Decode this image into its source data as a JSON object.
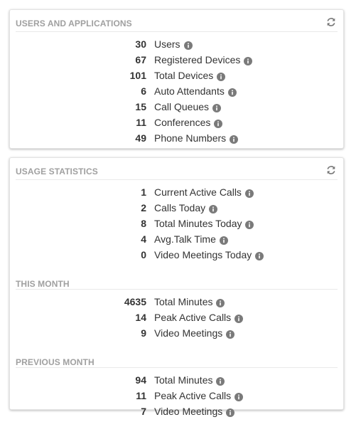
{
  "users_card": {
    "title": "USERS AND APPLICATIONS",
    "rows": [
      {
        "value": "30",
        "label": "Users"
      },
      {
        "value": "67",
        "label": "Registered Devices"
      },
      {
        "value": "101",
        "label": "Total Devices"
      },
      {
        "value": "6",
        "label": "Auto Attendants"
      },
      {
        "value": "15",
        "label": "Call Queues"
      },
      {
        "value": "11",
        "label": "Conferences"
      },
      {
        "value": "49",
        "label": "Phone Numbers"
      }
    ]
  },
  "usage_card": {
    "title": "USAGE STATISTICS",
    "today_rows": [
      {
        "value": "1",
        "label": "Current Active Calls"
      },
      {
        "value": "2",
        "label": "Calls Today"
      },
      {
        "value": "8",
        "label": "Total Minutes Today"
      },
      {
        "value": "4",
        "label": "Avg.Talk Time"
      },
      {
        "value": "0",
        "label": "Video Meetings Today"
      }
    ],
    "this_month_title": "THIS MONTH",
    "this_month_rows": [
      {
        "value": "4635",
        "label": "Total Minutes"
      },
      {
        "value": "14",
        "label": "Peak Active Calls"
      },
      {
        "value": "9",
        "label": "Video Meetings"
      }
    ],
    "previous_month_title": "PREVIOUS MONTH",
    "previous_month_rows": [
      {
        "value": "94",
        "label": "Total Minutes"
      },
      {
        "value": "11",
        "label": "Peak Active Calls"
      },
      {
        "value": "7",
        "label": "Video Meetings"
      }
    ]
  },
  "icons": {
    "refresh": "refresh-icon",
    "info": "info-icon"
  },
  "colors": {
    "section_title": "#a0a0a0",
    "text": "#333333",
    "info_icon": "#7a7a7a",
    "divider": "#e9e9e9"
  }
}
